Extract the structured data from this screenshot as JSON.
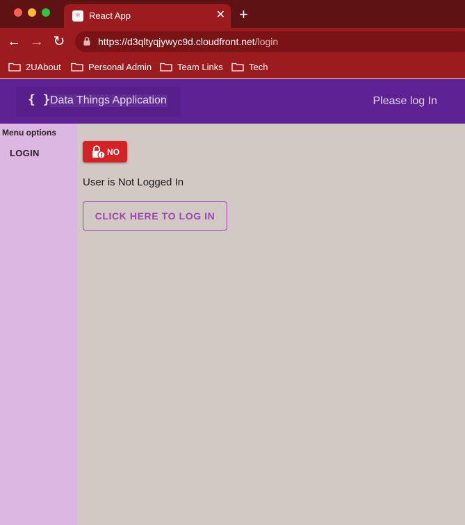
{
  "browser": {
    "tab_title": "React App",
    "tab_close": "✕",
    "new_tab": "+",
    "url_host": "https://d3qltyqjywyc9d.cloudfront.net",
    "url_path": "/login",
    "back": "←",
    "forward": "→",
    "reload": "↻",
    "bookmarks": [
      {
        "label": "2UAbout",
        "icon": "folder-icon"
      },
      {
        "label": "Personal Admin",
        "icon": "folder-icon"
      },
      {
        "label": "Team Links",
        "icon": "folder-icon"
      },
      {
        "label": "Tech",
        "icon": "folder-icon"
      }
    ]
  },
  "header": {
    "brand_icon": "{ }",
    "title": "Data Things Application",
    "login_status": "Please log In"
  },
  "sidebar": {
    "label": "Menu options",
    "items": [
      {
        "label": "LOGIN"
      }
    ]
  },
  "main": {
    "chip_label": "NO",
    "chip_icon": "lock-icon",
    "status_text": "User is Not Logged In",
    "login_button_label": "CLICK HERE TO LOG IN"
  },
  "colors": {
    "browser_frame": "#9c1b1e",
    "appbar": "#5e2295",
    "sidebar": "#dcb7e1",
    "main_bg": "#d2c8c4",
    "chip": "#d32326",
    "button_accent": "#9b46b0"
  }
}
